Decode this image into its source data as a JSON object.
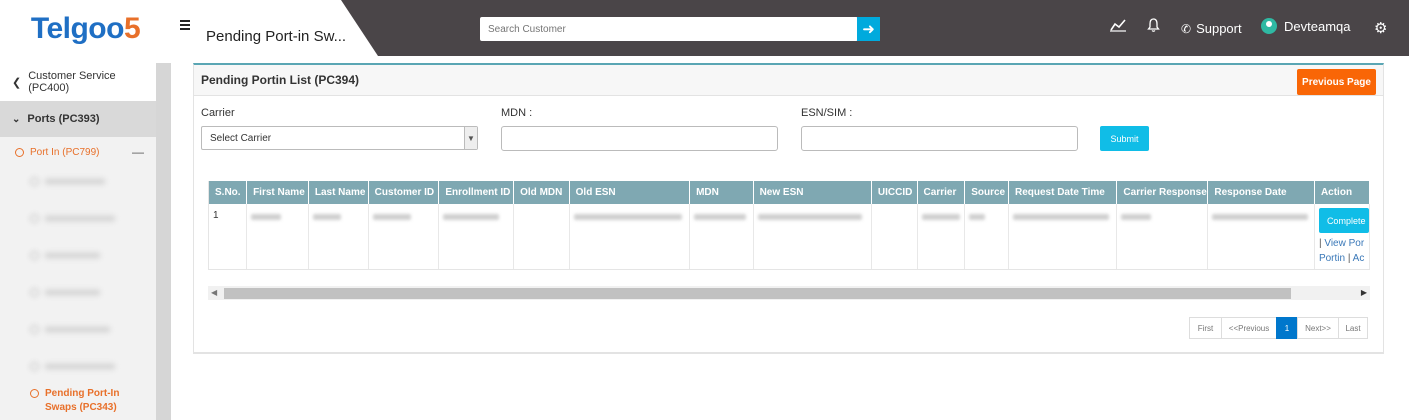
{
  "brand": {
    "logo_main": "Telgoo",
    "logo_num": "5"
  },
  "topbar": {
    "page_title": "Pending Port-in Sw...",
    "search_placeholder": "Search Customer",
    "support_label": "Support",
    "user_name": "Devteamqa"
  },
  "sidebar": {
    "back_label": "Customer Service (PC400)",
    "section_label": "Ports (PC393)",
    "group_label": "Port In (PC799)",
    "active_item_label": "Pending Port-In Swaps (PC343)"
  },
  "main": {
    "panel_title": "Pending Portin List (PC394)",
    "previous_page_label": "Previous Page",
    "form": {
      "carrier_label": "Carrier",
      "carrier_selected": "Select Carrier",
      "mdn_label": "MDN :",
      "esn_label": "ESN/SIM :",
      "submit_label": "Submit"
    },
    "table": {
      "columns": [
        "S.No.",
        "First Name",
        "Last Name",
        "Customer ID",
        "Enrollment ID",
        "Old MDN",
        "Old ESN",
        "MDN",
        "New ESN",
        "UICCID",
        "Carrier",
        "Source",
        "Request Date Time",
        "Carrier Response",
        "Response Date",
        "Action"
      ],
      "rows": [
        {
          "sno": "1",
          "complete_label": "Complete",
          "view_label": "View Por",
          "portin_label": "Portin",
          "action_label": "Ac"
        }
      ]
    },
    "pagination": {
      "first": "First",
      "previous": "<<Previous",
      "current": "1",
      "next": "Next>>",
      "last": "Last"
    }
  },
  "colors": {
    "topbar_bg": "#4a4548",
    "accent_orange": "#f96606",
    "accent_cyan": "#10bde7",
    "table_header": "#7fa8b2",
    "page_active": "#0077cc"
  }
}
